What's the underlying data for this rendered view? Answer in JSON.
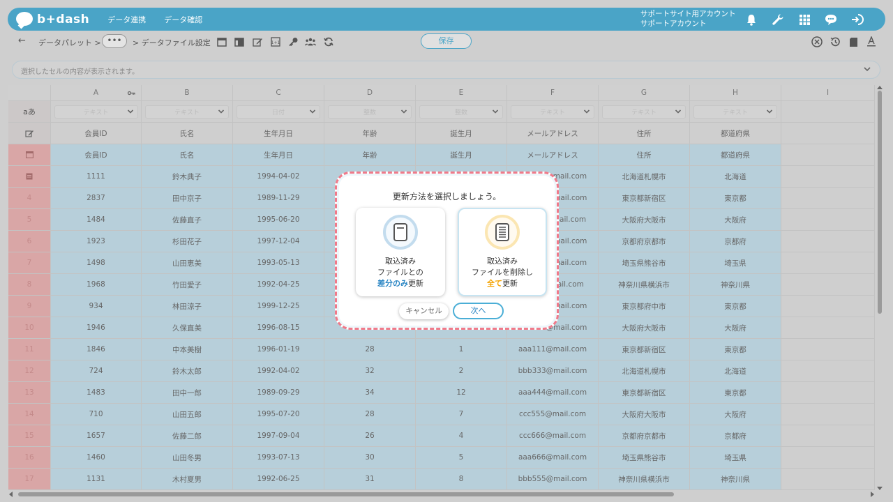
{
  "header": {
    "logo_text": "b+dash",
    "nav": [
      "データ連携",
      "データ確認"
    ],
    "account_line1": "サポートサイト用アカウント",
    "account_line2": "サポートアカウント"
  },
  "toolbar": {
    "breadcrumb_root": "データパレット >",
    "more_label": "•••",
    "breadcrumb_current": "> データファイル設定",
    "save_label": "保存"
  },
  "cellbar": {
    "placeholder": "選択したセルの内容が表示されます。"
  },
  "grid": {
    "columns": [
      {
        "letter": "A",
        "type": "テキスト",
        "label": "会員ID"
      },
      {
        "letter": "B",
        "type": "テキスト",
        "label": "氏名"
      },
      {
        "letter": "C",
        "type": "日付",
        "label": "生年月日"
      },
      {
        "letter": "D",
        "type": "整数",
        "label": "年齢"
      },
      {
        "letter": "E",
        "type": "整数",
        "label": "誕生月"
      },
      {
        "letter": "F",
        "type": "テキスト",
        "label": "メールアドレス"
      },
      {
        "letter": "G",
        "type": "テキスト",
        "label": "住所"
      },
      {
        "letter": "H",
        "type": "テキスト",
        "label": "都道府県"
      },
      {
        "letter": "I",
        "type": "",
        "label": ""
      }
    ],
    "type_row_label": "aあ",
    "rows": [
      {
        "num": "",
        "cells": [
          "1111",
          "鈴木典子",
          "1994-04-02",
          "",
          "",
          "aaa111@mail.com",
          "北海道札幌市",
          "北海道"
        ]
      },
      {
        "num": "4",
        "cells": [
          "2837",
          "田中京子",
          "1989-11-29",
          "",
          "",
          "bbb222@mail.com",
          "東京都新宿区",
          "東京都"
        ]
      },
      {
        "num": "5",
        "cells": [
          "1484",
          "佐藤直子",
          "1995-06-20",
          "",
          "",
          "ccc333@mail.com",
          "大阪府大阪市",
          "大阪府"
        ]
      },
      {
        "num": "6",
        "cells": [
          "1923",
          "杉田花子",
          "1997-12-04",
          "",
          "",
          "ddd444@mail.com",
          "京都府京都市",
          "京都府"
        ]
      },
      {
        "num": "7",
        "cells": [
          "1498",
          "山田恵美",
          "1993-05-13",
          "",
          "",
          "eee555@mail.com",
          "埼玉県熊谷市",
          "埼玉県"
        ]
      },
      {
        "num": "8",
        "cells": [
          "1968",
          "竹田愛子",
          "1992-04-25",
          "",
          "",
          "fff666@mail.com",
          "神奈川県横浜市",
          "神奈川県"
        ]
      },
      {
        "num": "9",
        "cells": [
          "934",
          "林田涼子",
          "1999-12-25",
          "",
          "",
          "ggg777@mail.com",
          "東京都府中市",
          "東京都"
        ]
      },
      {
        "num": "10",
        "cells": [
          "1946",
          "久保直美",
          "1996-08-15",
          "",
          "",
          "hhh888@mail.com",
          "大阪府大阪市",
          "大阪府"
        ]
      },
      {
        "num": "11",
        "cells": [
          "1846",
          "中本美樹",
          "1996-01-19",
          "28",
          "1",
          "aaa111@mail.com",
          "東京都新宿区",
          "東京都"
        ]
      },
      {
        "num": "12",
        "cells": [
          "724",
          "鈴木太郎",
          "1992-04-02",
          "32",
          "2",
          "bbb333@mail.com",
          "北海道札幌市",
          "北海道"
        ]
      },
      {
        "num": "13",
        "cells": [
          "1483",
          "田中一郎",
          "1989-09-29",
          "34",
          "12",
          "aaa444@mail.com",
          "東京都新宿区",
          "東京都"
        ]
      },
      {
        "num": "14",
        "cells": [
          "710",
          "山田五郎",
          "1995-07-20",
          "28",
          "7",
          "ccc555@mail.com",
          "大阪府大阪市",
          "大阪府"
        ]
      },
      {
        "num": "15",
        "cells": [
          "1657",
          "佐藤二郎",
          "1997-09-04",
          "26",
          "4",
          "ccc666@mail.com",
          "京都府京都市",
          "京都府"
        ]
      },
      {
        "num": "16",
        "cells": [
          "1460",
          "山田冬男",
          "1993-07-13",
          "30",
          "5",
          "aaa666@mail.com",
          "埼玉県熊谷市",
          "埼玉県"
        ]
      },
      {
        "num": "17",
        "cells": [
          "1131",
          "木村夏男",
          "1992-06-25",
          "31",
          "8",
          "bbb555@mail.com",
          "神奈川県横浜市",
          "神奈川県"
        ]
      }
    ]
  },
  "modal": {
    "title": "更新方法を選択しましょう。",
    "option_a": {
      "line1": "取込済み",
      "line2": "ファイルとの",
      "highlight": "差分のみ",
      "suffix": "更新"
    },
    "option_b": {
      "line1": "取込済み",
      "line2": "ファイルを削除し",
      "highlight": "全て",
      "suffix": "更新"
    },
    "cancel_label": "キャンセル",
    "next_label": "次へ"
  },
  "colors": {
    "brand": "#4aa4c7",
    "highlight_blue": "#2b86c4",
    "highlight_orange": "#f4a300",
    "modal_border": "#f07a8a"
  }
}
